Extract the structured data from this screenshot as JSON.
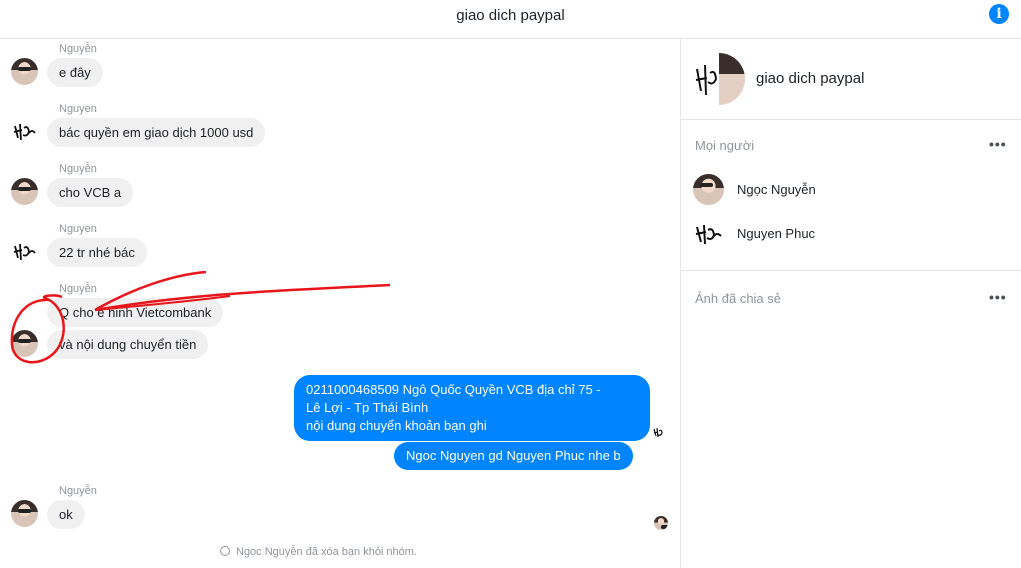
{
  "header": {
    "title": "giao dich paypal",
    "info_icon": "info-icon"
  },
  "messages": [
    {
      "sender": "Nguyễn",
      "texts": [
        "e đây"
      ]
    },
    {
      "sender": "Nguyen",
      "texts": [
        "bác quyền em giao dịch  1000 usd"
      ]
    },
    {
      "sender": "Nguyễn",
      "texts": [
        "cho VCB a"
      ]
    },
    {
      "sender": "Nguyen",
      "texts": [
        "22 tr nhé bác"
      ]
    },
    {
      "sender": "Nguyễn",
      "texts": [
        "Q cho e hinh Vietcombank",
        "và nội dung chuyển tiền"
      ]
    },
    {
      "outgoing": true,
      "texts": [
        "0211000468509 Ngô Quốc Quyền VCB địa chỉ  75 -",
        "Lê Lợi - Tp Thái Bình",
        "nội dung chuyển khoản bạn ghi",
        "Ngoc Nguyen gd Nguyen Phuc nhe b"
      ]
    },
    {
      "sender": "Nguyễn",
      "texts": [
        "ok"
      ]
    }
  ],
  "system_message": "Ngọc Nguyễn đã xóa bạn khỏi nhóm.",
  "sidebar": {
    "title": "giao dich paypal",
    "people_label": "Mọi người",
    "members": [
      {
        "name": "Ngọc Nguyễn"
      },
      {
        "name": "Nguyen Phuc"
      }
    ],
    "shared_label": "Ảnh đã chia sẻ",
    "more_label": "•••"
  },
  "colors": {
    "accent": "#0084ff",
    "bubble_in": "#f1f0f0",
    "annotation": "#e8151b"
  }
}
